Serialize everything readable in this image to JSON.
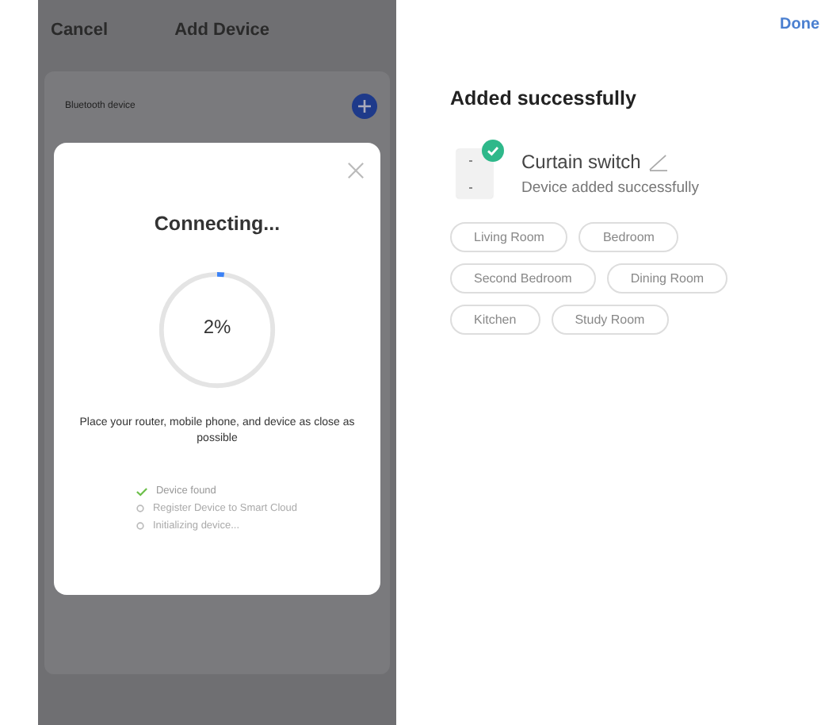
{
  "left_screen": {
    "header": {
      "cancel": "Cancel",
      "title": "Add Device"
    },
    "list": [
      {
        "label": "Bluetooth device"
      }
    ],
    "dialog": {
      "title": "Connecting...",
      "progress": {
        "level": 0.02,
        "reading": "2%"
      },
      "hint": "Place your router, mobile phone, and device as close as possible",
      "steps": [
        {
          "label": "Device found",
          "done": true
        },
        {
          "label": "Register Device to Smart Cloud",
          "done": false
        },
        {
          "label": "Initializing device...",
          "done": false
        }
      ]
    }
  },
  "right_screen": {
    "done": "Done",
    "heading": "Added successfully",
    "device": {
      "name": "Curtain switch",
      "status": "Device added successfully",
      "added": true
    },
    "rooms": [
      {
        "label": "Living Room",
        "selected": false
      },
      {
        "label": "Bedroom",
        "selected": false
      },
      {
        "label": "Second Bedroom",
        "selected": false
      },
      {
        "label": "Dining Room",
        "selected": false
      },
      {
        "label": "Kitchen",
        "selected": false
      },
      {
        "label": "Study Room",
        "selected": false
      }
    ]
  }
}
